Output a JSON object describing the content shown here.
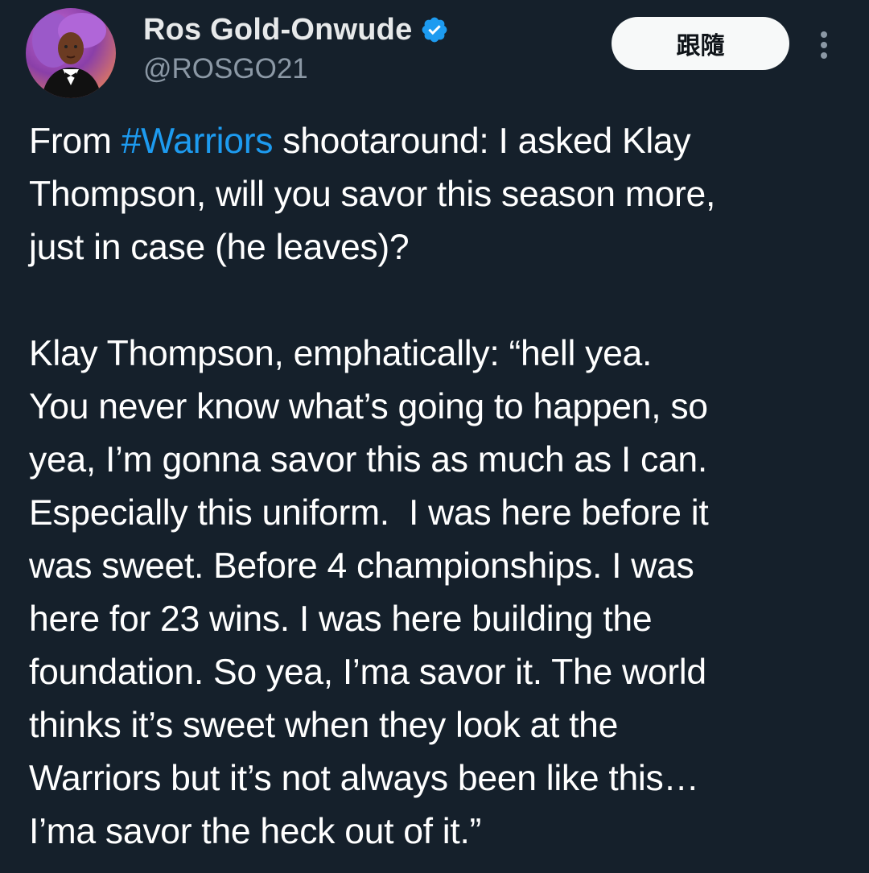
{
  "author": {
    "display_name": "Ros Gold-Onwude",
    "handle": "@ROSGO21",
    "verified": true,
    "avatar_icon": "profile-avatar"
  },
  "actions": {
    "follow_label": "跟隨",
    "more_icon": "more-vertical-icon"
  },
  "tweet": {
    "paragraph1": {
      "line1_prefix": "From ",
      "hashtag": "#Warriors",
      "line1_suffix": " shootaround: I asked Klay",
      "line2": "Thompson, will you savor this season more,",
      "line3": "just in case (he leaves)?"
    },
    "paragraph2": [
      "Klay Thompson, emphatically: “hell yea.",
      "You never know what’s going to happen, so",
      "yea, I’m gonna savor this as much as I can.",
      "Especially this uniform.  I was here before it",
      "was sweet. Before 4 championships. I was",
      "here for 23 wins. I was here building the",
      "foundation. So yea, I’ma savor it. The world",
      "thinks it’s sweet when they look at the",
      "Warriors but it’s not always been like this…",
      "I’ma savor the heck out of it.”"
    ]
  },
  "colors": {
    "background": "#15202b",
    "text": "#ffffff",
    "secondary_text": "#8b98a5",
    "link": "#1d9bf0",
    "verified": "#1d9bf0",
    "follow_button_bg": "#f7f9f9"
  }
}
